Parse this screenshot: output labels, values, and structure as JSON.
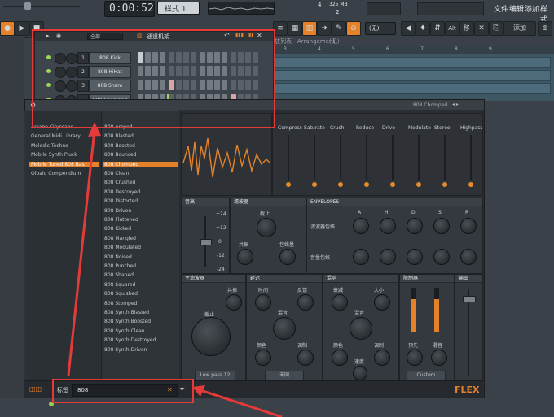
{
  "toolbar": {
    "time": "0:00:52",
    "time_small": "49",
    "pattern_label": "样式 1",
    "cpu_mem": "325 MB",
    "cpu_num": "4",
    "voices": "2",
    "snap": "(无)",
    "menu": [
      "文件",
      "编辑",
      "添加",
      "样式"
    ],
    "btn_add": "添加",
    "btn_alt": "Alt",
    "btn_move": "移"
  },
  "playlist": {
    "title": "播放列表 - Arrangement",
    "title_suffix": "(无)",
    "bar_numbers": [
      "3",
      "4",
      "5",
      "6",
      "7",
      "8",
      "9"
    ]
  },
  "channel_rack": {
    "filter": "全部",
    "title": "通道机架",
    "channels": [
      {
        "num": "1",
        "name": "808 Kick"
      },
      {
        "num": "2",
        "name": "808 HiHat"
      },
      {
        "num": "3",
        "name": "808 Snare"
      },
      {
        "num": "—",
        "name": "808 Chomped"
      }
    ],
    "add_button": "+"
  },
  "plugin_window": {
    "title": "808 Chomped",
    "nav": "◂ ▸"
  },
  "browser": {
    "libraries": [
      "Arkaoo Cityscape",
      "General Midi Library",
      "Melodic Techno",
      "Mobile Synth Pluck",
      "Mobile Tuned 808 Bas",
      "Olbaid Compendium"
    ],
    "library_selected_index": 4,
    "presets": [
      "808 Amped",
      "808 Blasted",
      "808 Boosted",
      "808 Bounced",
      "808 Chomped",
      "808 Clean",
      "808 Crushed",
      "808 Destroyed",
      "808 Distorted",
      "808 Driven",
      "808 Flattened",
      "808 Kicked",
      "808 Mangled",
      "808 Modulated",
      "808 Noised",
      "808 Punched",
      "808 Shaped",
      "808 Squared",
      "808 Squished",
      "808 Stomped",
      "808 Synth Blasted",
      "808 Synth Boosted",
      "808 Synth Clean",
      "808 Synth Destroyed",
      "808 Synth Driven"
    ],
    "preset_selected_index": 4
  },
  "macros": [
    "Compress",
    "Saturate",
    "Crush",
    "Reduce",
    "Drive",
    "Modulate",
    "Stereo",
    "Highpass"
  ],
  "pitch": {
    "title": "音高",
    "scale": [
      "+24",
      "+12",
      "0",
      "-12",
      "-24"
    ]
  },
  "filter_panel": {
    "title": "滤波器",
    "cutoff": "截止",
    "resonance": "共振",
    "envelope_amount": "包络量"
  },
  "envelopes": {
    "title": "ENVELOPES",
    "cols": [
      "A",
      "H",
      "D",
      "S",
      "R"
    ],
    "row_filter": "滤波器包络",
    "row_volume": "音量包络"
  },
  "master_filter": {
    "title": "主滤波器",
    "resonance": "共振",
    "cutoff": "截止",
    "type": "Low pass 12"
  },
  "delay": {
    "title": "延迟",
    "time": "时间",
    "feedback": "反馈",
    "mix": "混音",
    "color": "颜色",
    "modulation": "调制",
    "sync": "未同"
  },
  "reverb": {
    "title": "混响",
    "decay": "衰减",
    "size": "大小",
    "mix": "混音",
    "color": "颜色",
    "modulation": "调制",
    "speed": "速度"
  },
  "limiter": {
    "title": "限制器",
    "pre": "预先",
    "mix": "混音",
    "mode": "Custom"
  },
  "output": {
    "title": "输出"
  },
  "status": {
    "tag_label": "标签",
    "search_value": "808",
    "brand": "FLEX"
  },
  "colors": {
    "accent": "#e4822a",
    "highlight_box": "#e53a3a"
  }
}
